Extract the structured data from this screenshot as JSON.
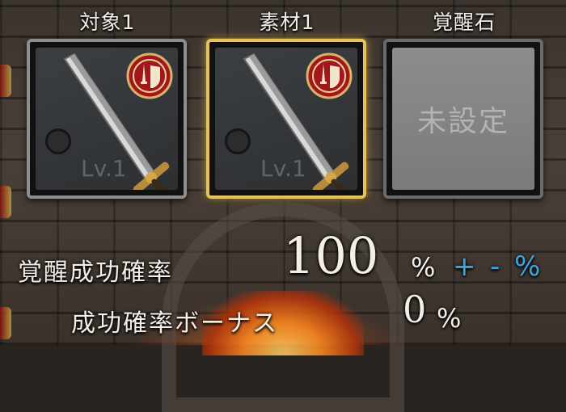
{
  "slots": [
    {
      "label": "対象1",
      "level": "Lv.1",
      "item": "sword-icon",
      "badge": "attack-defense-emblem-icon",
      "state": "normal"
    },
    {
      "label": "素材1",
      "level": "Lv.1",
      "item": "sword-icon",
      "badge": "attack-defense-emblem-icon",
      "state": "selected"
    },
    {
      "label": "覚醒石",
      "empty_text": "未設定",
      "state": "empty"
    }
  ],
  "awaken_rate": {
    "label": "覚醒成功確率",
    "value": "100",
    "unit": "%",
    "plus": "+",
    "minus": "-",
    "adj_unit": "%"
  },
  "bonus_rate": {
    "label": "成功確率ボーナス",
    "value": "0",
    "unit": "%"
  },
  "colors": {
    "selected_border": "#e6c25a",
    "adjust_blue": "#3fa3e0",
    "emblem_red": "#a3161a"
  }
}
